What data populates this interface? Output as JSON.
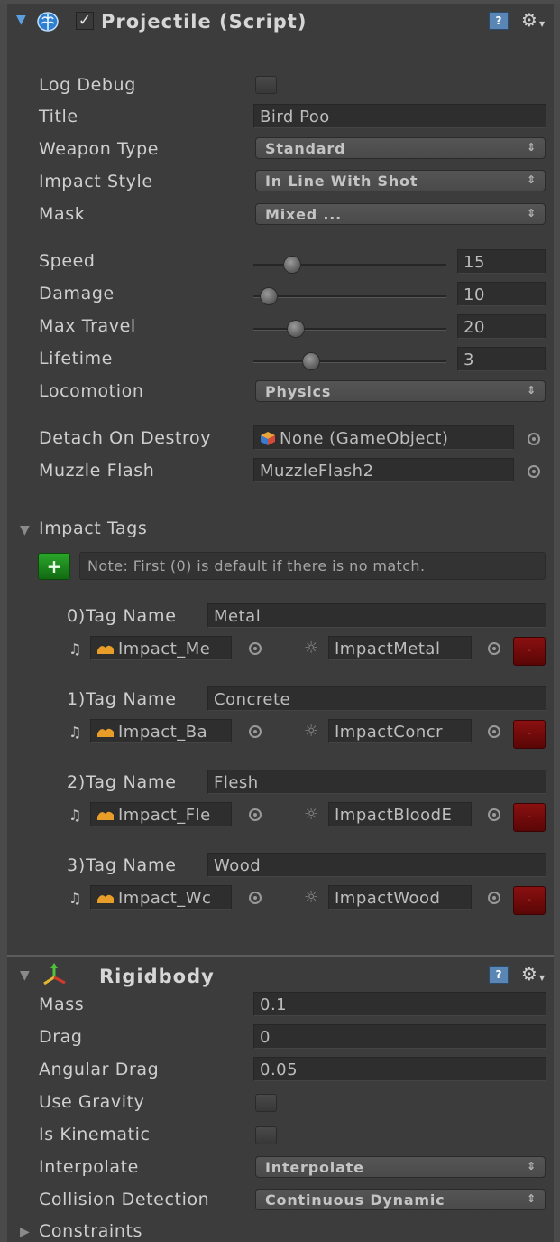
{
  "script_component": {
    "title": "Projectile (Script)",
    "icons": {
      "brain": "brain-script-icon",
      "checkbox": "enabled-checkbox",
      "help": "help-book-icon",
      "gear": "gear-icon"
    },
    "log_debug": {
      "label": "Log Debug",
      "checked": false
    },
    "title_field": {
      "label": "Title",
      "value": "Bird Poo"
    },
    "weapon_type": {
      "label": "Weapon Type",
      "value": "Standard"
    },
    "impact_style": {
      "label": "Impact Style",
      "value": "In Line With Shot"
    },
    "mask": {
      "label": "Mask",
      "value": "Mixed ..."
    },
    "speed": {
      "label": "Speed",
      "value": "15",
      "fraction": 0.2
    },
    "damage": {
      "label": "Damage",
      "value": "10",
      "fraction": 0.08
    },
    "max_travel": {
      "label": "Max Travel",
      "value": "20",
      "fraction": 0.22
    },
    "lifetime": {
      "label": "Lifetime",
      "value": "3",
      "fraction": 0.3
    },
    "locomotion": {
      "label": "Locomotion",
      "value": "Physics"
    },
    "detach_on_destroy": {
      "label": "Detach On Destroy",
      "value": "None (GameObject)"
    },
    "muzzle_flash": {
      "label": "Muzzle Flash",
      "value": "MuzzleFlash2"
    },
    "impact_tags": {
      "label": "Impact Tags",
      "add_label": "+",
      "note": "Note: First (0) is default if there is no match.",
      "tag_name_suffix": "Tag Name",
      "remove_label": "-",
      "items": [
        {
          "index": "0)",
          "name": "Metal",
          "audio": "Impact_Me",
          "effect": "ImpactMetal"
        },
        {
          "index": "1)",
          "name": "Concrete",
          "audio": "Impact_Ba",
          "effect": "ImpactConcr"
        },
        {
          "index": "2)",
          "name": "Flesh",
          "audio": "Impact_Fle",
          "effect": "ImpactBloodE"
        },
        {
          "index": "3)",
          "name": "Wood",
          "audio": "Impact_Wc",
          "effect": "ImpactWood"
        }
      ]
    }
  },
  "rigidbody_component": {
    "title": "Rigidbody",
    "mass": {
      "label": "Mass",
      "value": "0.1"
    },
    "drag": {
      "label": "Drag",
      "value": "0"
    },
    "angular_drag": {
      "label": "Angular Drag",
      "value": "0.05"
    },
    "use_gravity": {
      "label": "Use Gravity",
      "checked": false
    },
    "is_kinematic": {
      "label": "Is Kinematic",
      "checked": false
    },
    "interpolate": {
      "label": "Interpolate",
      "value": "Interpolate"
    },
    "collision_detection": {
      "label": "Collision Detection",
      "value": "Continuous Dynamic"
    },
    "constraints": {
      "label": "Constraints"
    }
  },
  "colors": {
    "panel_bg": "#3c3c3c",
    "field_bg": "#2e2e2e",
    "add_button": "#1f8a1f",
    "remove_button": "#7a0c0c",
    "help_icon": "#5a86b5"
  }
}
